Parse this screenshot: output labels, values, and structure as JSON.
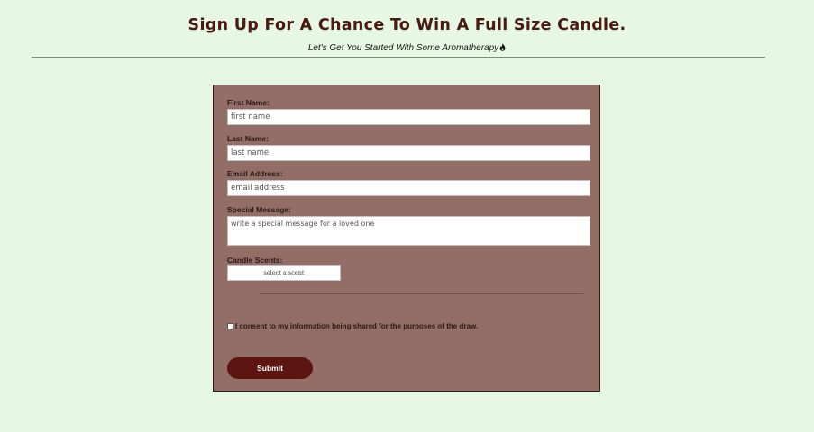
{
  "header": {
    "title": "Sign Up For A Chance To Win A Full Size Candle.",
    "subtitle": "Let's Get You Started With Some Aromatherapy"
  },
  "form": {
    "first_name": {
      "label": "First Name:",
      "placeholder": "first name"
    },
    "last_name": {
      "label": "Last Name:",
      "placeholder": "last name"
    },
    "email": {
      "label": "Email Address:",
      "placeholder": "email address"
    },
    "message": {
      "label": "Special Message:",
      "placeholder": "write a special message for a loved one"
    },
    "scents": {
      "label": "Candle Scents:",
      "selected": "select a scent"
    },
    "consent": {
      "label": "I consent to my information being shared for the purposes of the draw.",
      "checked": false
    },
    "submit_label": "Submit"
  },
  "colors": {
    "background": "#e6f7e4",
    "card": "#936e66",
    "title": "#4a1a10",
    "button": "#5c1510"
  },
  "icons": {
    "subtitle_icon": "flame-icon"
  }
}
